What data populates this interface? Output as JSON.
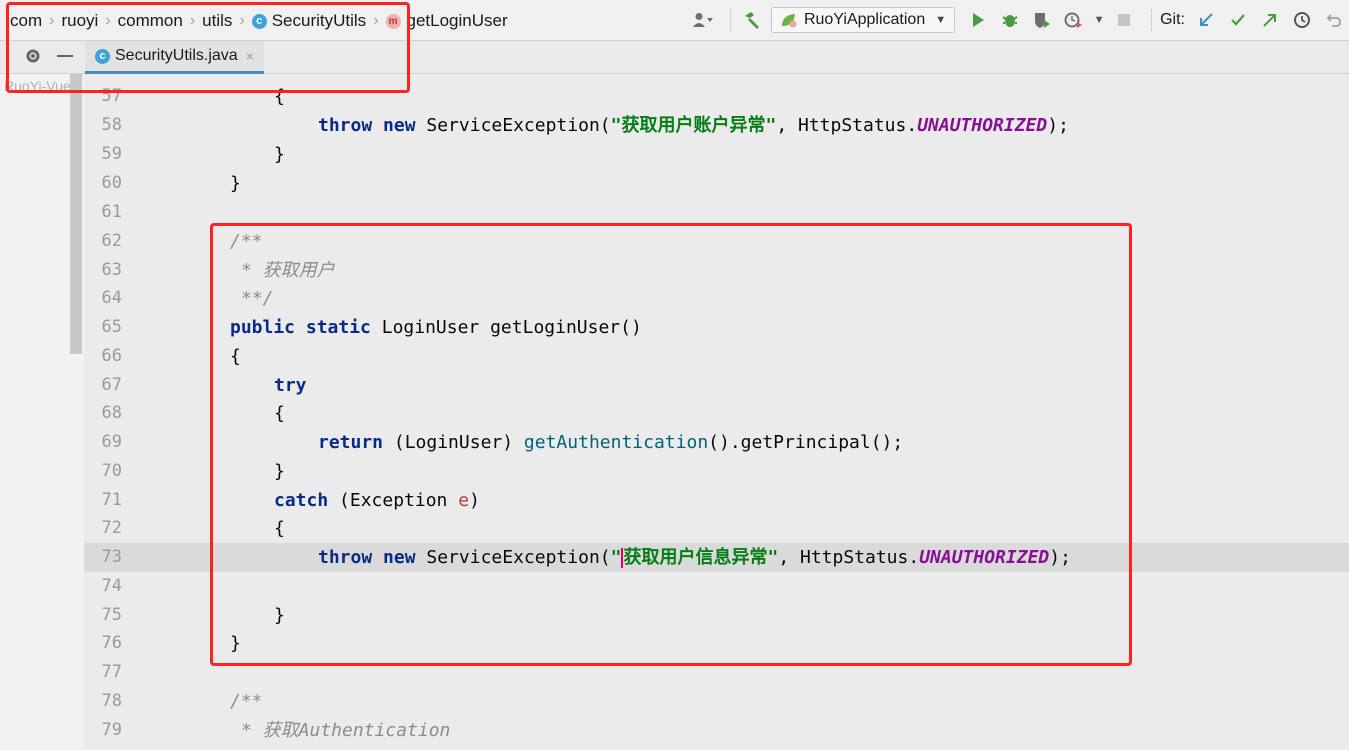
{
  "breadcrumb": {
    "items": [
      "com",
      "ruoyi",
      "common",
      "utils",
      "SecurityUtils",
      "getLoginUser"
    ]
  },
  "toolbar": {
    "run_config": "RuoYiApplication",
    "git_label": "Git:"
  },
  "tab": {
    "label": "SecurityUtils.java",
    "close": "×"
  },
  "project": {
    "label": "RuoYi-Vue"
  },
  "code": {
    "lines": [
      {
        "num": "57",
        "text": "{"
      },
      {
        "num": "58",
        "text": "throw new ServiceException(\"获取用户账户异常\", HttpStatus.UNAUTHORIZED);"
      },
      {
        "num": "59",
        "text": "}"
      },
      {
        "num": "60",
        "text": "}"
      },
      {
        "num": "61",
        "text": ""
      },
      {
        "num": "62",
        "text": "/**"
      },
      {
        "num": "63",
        "text": "* 获取用户"
      },
      {
        "num": "64",
        "text": "**/"
      },
      {
        "num": "65",
        "text": "public static LoginUser getLoginUser()"
      },
      {
        "num": "66",
        "text": "{"
      },
      {
        "num": "67",
        "text": "try"
      },
      {
        "num": "68",
        "text": "{"
      },
      {
        "num": "69",
        "text": "return (LoginUser) getAuthentication().getPrincipal();"
      },
      {
        "num": "70",
        "text": "}"
      },
      {
        "num": "71",
        "text": "catch (Exception e)"
      },
      {
        "num": "72",
        "text": "{"
      },
      {
        "num": "73",
        "text": "throw new ServiceException(\"获取用户信息异常\", HttpStatus.UNAUTHORIZED);"
      },
      {
        "num": "74",
        "text": ""
      },
      {
        "num": "75",
        "text": "}"
      },
      {
        "num": "76",
        "text": "}"
      },
      {
        "num": "77",
        "text": ""
      },
      {
        "num": "78",
        "text": "/**"
      },
      {
        "num": "79",
        "text": "* 获取Authentication"
      }
    ]
  },
  "colors": {
    "keyword": "#0a2a8a",
    "string": "#067d17",
    "constant": "#871094",
    "comment": "#8c8c8c",
    "annotation_box": "#ff2020",
    "tab_underline": "#4a88c7"
  }
}
